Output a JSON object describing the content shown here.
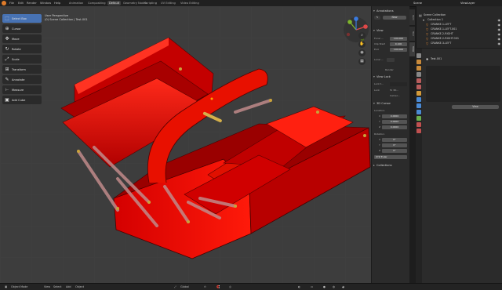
{
  "topbar": {
    "menus": [
      "File",
      "Edit",
      "Render",
      "Window",
      "Help"
    ],
    "workspaces": [
      "Animation",
      "Compositing",
      "Default",
      "Geometry Nodes",
      "Scripting",
      "UV Editing",
      "Video Editing"
    ],
    "active_workspace": "Default",
    "scene_label": "Scene",
    "view_layer_label": "ViewLayer"
  },
  "viewport": {
    "header_items": [
      "Object Mode",
      "View",
      "Select",
      "Add",
      "Object"
    ],
    "view_name": "User Perspective",
    "collection_path": "(0) Scene Collection | Test.001",
    "transform_orientation": "Global"
  },
  "toolbar": {
    "tools": [
      {
        "label": "Select Box",
        "icon": "select-box-icon",
        "glyph": "⬚",
        "active": true
      },
      {
        "label": "Cursor",
        "icon": "cursor-icon",
        "glyph": "⊕",
        "active": false
      },
      {
        "label": "Move",
        "icon": "move-icon",
        "glyph": "✥",
        "active": false
      },
      {
        "label": "Rotate",
        "icon": "rotate-icon",
        "glyph": "↻",
        "active": false
      },
      {
        "label": "Scale",
        "icon": "scale-icon",
        "glyph": "⤢",
        "active": false
      },
      {
        "label": "Transform",
        "icon": "transform-icon",
        "glyph": "⊞",
        "active": false
      },
      {
        "label": "Annotate",
        "icon": "annotate-icon",
        "glyph": "✎",
        "active": false
      },
      {
        "label": "Measure",
        "icon": "measure-icon",
        "glyph": "📏",
        "active": false
      },
      {
        "label": "Add Cube",
        "icon": "add-cube-icon",
        "glyph": "▣",
        "active": false
      }
    ]
  },
  "npanel": {
    "annotations_title": "Annotations",
    "new_button": "New",
    "view_title": "View",
    "focal_label": "Focal ...",
    "focal_value": "100.000",
    "clip_start_label": "Clip Start",
    "clip_start_value": "0.100",
    "clip_end_label": "End",
    "clip_end_value": "100.000",
    "local_camera_label": "Local ...",
    "render_region_label": "Render",
    "view_lock_title": "View Lock",
    "lock_to_object_label": "Lock t...",
    "lock_label": "Lock",
    "to_3d_label": "To 3D...",
    "camera_label": "Camer...",
    "cursor_title": "3D Cursor",
    "location_label": "Location:",
    "loc_x": "0.0000",
    "loc_y": "0.0000",
    "loc_z": "0.0000",
    "rotation_label": "Rotation:",
    "rot_x": "0°",
    "rot_y": "0°",
    "rot_z": "0°",
    "rotation_mode": "XYZ Euler",
    "collections_title": "Collections",
    "tabs": [
      "Item",
      "Tool",
      "View"
    ]
  },
  "outliner": {
    "root": "Scene Collection",
    "collection": "Collection 1",
    "items": [
      "CRANKE.1-LEFT",
      "CRANKE.1-LEFT.001",
      "CRANKE.2-RIGHT",
      "CRANKE.2-RIGHT.001",
      "CRANKE.3-LEFT"
    ]
  },
  "properties": {
    "object_name": "Test.001",
    "view_button": "View"
  },
  "colors": {
    "toolbox_red": "#e00000",
    "accent_blue": "#4772b3",
    "outliner_orange": "#e88a33"
  }
}
